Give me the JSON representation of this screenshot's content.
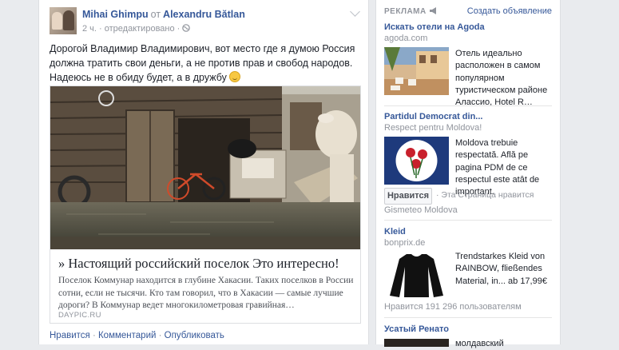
{
  "post": {
    "author": "Mihai Ghimpu",
    "from_word": "от",
    "target": "Alexandru Bătlan",
    "time": "2 ч.",
    "edited": "отредактировано",
    "privacy_icon": "globe-icon",
    "text_main": "Дорогой Владимир Владимирович, вот место где я думою Россия должна тратить свои деньги, а не против прав и свобод народов. Надеюсь не в обиду будет, а в дружбу",
    "link": {
      "title": "» Настоящий российский поселок Это интересно!",
      "description": "Поселок Коммунар находится в глубине Хакасии. Таких поселков в России сотни, если не тысячи. Кто там говорил, что в Хакасии — самые лучшие дороги? В Коммунар ведет многокилометровая гравийная…",
      "source": "DAYPIC.RU"
    },
    "actions": {
      "like": "Нравится",
      "comment": "Комментарий",
      "share": "Опубликовать"
    }
  },
  "right_column": {
    "heading": "РЕКЛАМА",
    "create_ad": "Создать объявление",
    "ads": [
      {
        "title": "Искать отели на Agoda",
        "domain": "agoda.com",
        "text": "Отель идеально расположен в самом популярном туристическом районе Алассио, Hotel R…"
      },
      {
        "title": "Partidul Democrat din...",
        "domain": "Respect pentru Moldova!",
        "text": "Moldova trebuie respectată. Află pe pagina PDM de ce respectul este atât de important.",
        "like_button": "Нравится",
        "like_meta": "· Эта Страница нравится",
        "footer": "Gismeteo Moldova"
      },
      {
        "title": "Kleid",
        "domain": "bonprix.de",
        "text": "Trendstarkes Kleid von RAINBOW, fließendes Material, in... ab 17,99€",
        "footer": "Нравится 191 296 пользователям"
      },
      {
        "title": "Усатый Ренато",
        "text": "молдавский"
      }
    ]
  }
}
